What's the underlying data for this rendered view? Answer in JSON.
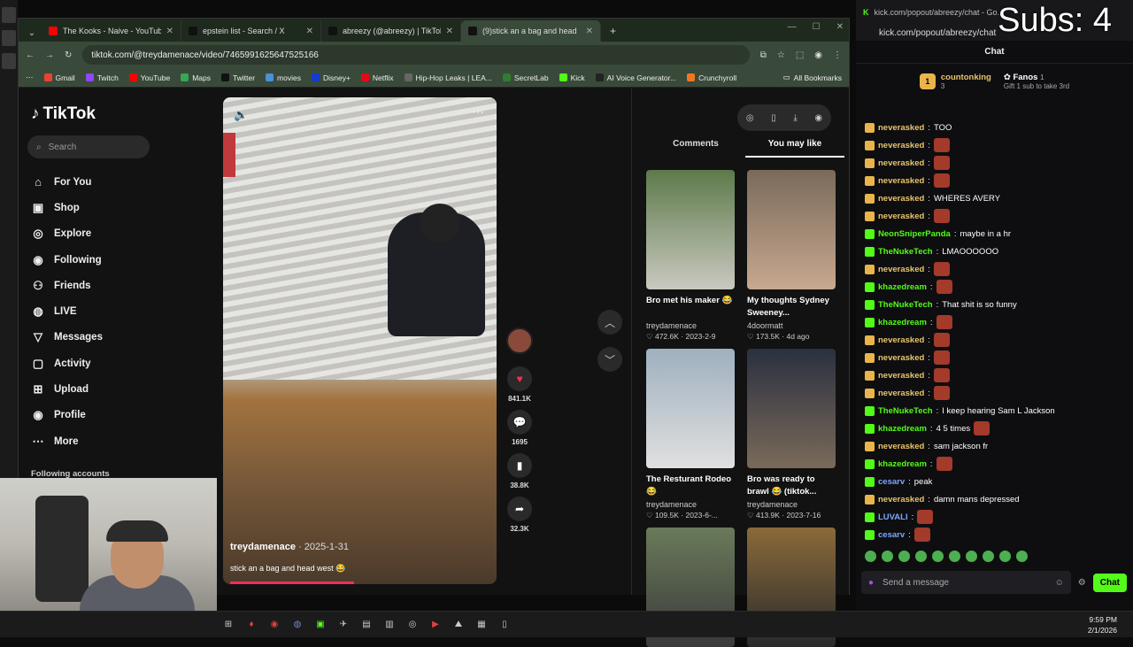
{
  "browser": {
    "tabs": [
      {
        "title": "The Kooks - Naive - YouTube",
        "color": "#ff0000",
        "active": false
      },
      {
        "title": "epstein list - Search / X",
        "color": "#111111",
        "active": false
      },
      {
        "title": "abreezy (@abreezy) | TikTok",
        "color": "#111111",
        "active": false
      },
      {
        "title": "(9)stick an a bag and head",
        "color": "#111111",
        "active": true
      }
    ],
    "url": "tiktok.com/@treydamenace/video/7465991625647525166",
    "bookmarks": [
      {
        "label": "Gmail",
        "color": "#ea4335"
      },
      {
        "label": "Twitch",
        "color": "#9146ff"
      },
      {
        "label": "YouTube",
        "color": "#ff0000"
      },
      {
        "label": "Maps",
        "color": "#34a853"
      },
      {
        "label": "Twitter",
        "color": "#111111"
      },
      {
        "label": "movies",
        "color": "#4a90d9"
      },
      {
        "label": "Disney+",
        "color": "#113ccf"
      },
      {
        "label": "Netflix",
        "color": "#e50914"
      },
      {
        "label": "Hip-Hop Leaks | LEA...",
        "color": "#666666"
      },
      {
        "label": "SecretLab",
        "color": "#2e7d32"
      },
      {
        "label": "Kick",
        "color": "#53fc18"
      },
      {
        "label": "AI Voice Generator...",
        "color": "#222222"
      },
      {
        "label": "Crunchyroll",
        "color": "#f47521"
      }
    ],
    "all_bookmarks": "All Bookmarks"
  },
  "tiktok": {
    "logo": "TikTok",
    "search_placeholder": "Search",
    "nav": [
      {
        "label": "For You",
        "icon": "home-icon"
      },
      {
        "label": "Shop",
        "icon": "shop-icon"
      },
      {
        "label": "Explore",
        "icon": "compass-icon"
      },
      {
        "label": "Following",
        "icon": "avatar-icon"
      },
      {
        "label": "Friends",
        "icon": "friends-icon"
      },
      {
        "label": "LIVE",
        "icon": "live-icon"
      },
      {
        "label": "Messages",
        "icon": "messages-icon"
      },
      {
        "label": "Activity",
        "icon": "activity-icon"
      },
      {
        "label": "Upload",
        "icon": "upload-icon"
      },
      {
        "label": "Profile",
        "icon": "profile-icon"
      },
      {
        "label": "More",
        "icon": "more-icon"
      }
    ],
    "following_accounts": "Following accounts",
    "video": {
      "user": "treydamenace",
      "date": "· 2025-1-31",
      "caption": "stick an a bag and head west 😂"
    },
    "actions": {
      "likes": "841.1K",
      "comments": "1695",
      "saves": "38.8K",
      "shares": "32.3K"
    },
    "panel_tabs": [
      "Comments",
      "You may like"
    ],
    "cards": [
      {
        "title": "Bro met his maker 😂",
        "user": "treydamenace",
        "meta": "♡ 472.6K · 2023-2-9",
        "c1": "#5d7a4a",
        "c2": "#c9c9c0"
      },
      {
        "title": "My thoughts Sydney Sweeney...",
        "user": "4doormatt",
        "meta": "♡ 173.5K · 4d ago",
        "c1": "#7a6a5a",
        "c2": "#c8a890"
      },
      {
        "title": "The Resturant Rodeo 😂",
        "user": "treydamenace",
        "meta": "♡ 109.5K · 2023-6-...",
        "c1": "#9fb0bf",
        "c2": "#e0e0e0"
      },
      {
        "title": "Bro was ready to brawl 😂 (tiktok...",
        "user": "treydamenace",
        "meta": "♡ 413.9K · 2023-7-16",
        "c1": "#2a3040",
        "c2": "#7a6a5a"
      },
      {
        "title": "",
        "user": "",
        "meta": "",
        "c1": "#6a7a5a",
        "c2": "#3a3a3a"
      },
      {
        "title": "",
        "user": "",
        "meta": "",
        "c1": "#8a6a3a",
        "c2": "#2a2a2a"
      }
    ]
  },
  "chat": {
    "popout_url": "kick.com/popout/abreezy/chat - Go...",
    "popout_url2": "kick.com/popout/abreezy/chat",
    "subs": "Subs: 4",
    "title": "Chat",
    "leader": {
      "rank": "1",
      "name": "countonking",
      "count": "3",
      "name2": "Fanos",
      "count2": "1",
      "sub": "Gift 1 sub to take 3rd"
    },
    "messages": [
      {
        "user": "neverasked",
        "text": "TOO",
        "color": "#e9c46a",
        "emote": false
      },
      {
        "user": "neverasked",
        "text": "",
        "color": "#e9c46a",
        "emote": true
      },
      {
        "user": "neverasked",
        "text": "",
        "color": "#e9c46a",
        "emote": true
      },
      {
        "user": "neverasked",
        "text": "",
        "color": "#e9c46a",
        "emote": true
      },
      {
        "user": "neverasked",
        "text": "WHERES AVERY",
        "color": "#e9c46a",
        "emote": false
      },
      {
        "user": "neverasked",
        "text": "",
        "color": "#e9c46a",
        "emote": true
      },
      {
        "user": "NeonSniperPanda",
        "text": "maybe in a hr",
        "color": "#53fc18",
        "emote": false
      },
      {
        "user": "TheNukeTech",
        "text": "LMAOOOOOO",
        "color": "#53fc18",
        "emote": false
      },
      {
        "user": "neverasked",
        "text": "",
        "color": "#e9c46a",
        "emote": true
      },
      {
        "user": "khazedream",
        "text": "",
        "color": "#53fc18",
        "emote": true
      },
      {
        "user": "TheNukeTech",
        "text": "That shit is so funny",
        "color": "#53fc18",
        "emote": false
      },
      {
        "user": "khazedream",
        "text": "",
        "color": "#53fc18",
        "emote": true
      },
      {
        "user": "neverasked",
        "text": "",
        "color": "#e9c46a",
        "emote": true
      },
      {
        "user": "neverasked",
        "text": "",
        "color": "#e9c46a",
        "emote": true
      },
      {
        "user": "neverasked",
        "text": "",
        "color": "#e9c46a",
        "emote": true
      },
      {
        "user": "neverasked",
        "text": "",
        "color": "#e9c46a",
        "emote": true
      },
      {
        "user": "TheNukeTech",
        "text": "I keep hearing Sam L Jackson",
        "color": "#53fc18",
        "emote": false
      },
      {
        "user": "khazedream",
        "text": "4 5 times",
        "color": "#53fc18",
        "emote": true
      },
      {
        "user": "neverasked",
        "text": "sam jackson fr",
        "color": "#e9c46a",
        "emote": false
      },
      {
        "user": "khazedream",
        "text": "",
        "color": "#53fc18",
        "emote": true
      },
      {
        "user": "cesarv",
        "text": "peak",
        "color": "#7aa7ff",
        "emote": false
      },
      {
        "user": "neverasked",
        "text": "damn mans depressed",
        "color": "#e9c46a",
        "emote": false
      },
      {
        "user": "LUVALI",
        "text": "",
        "color": "#7aa7ff",
        "emote": true
      },
      {
        "user": "cesarv",
        "text": "",
        "color": "#7aa7ff",
        "emote": true
      }
    ],
    "input_placeholder": "Send a message",
    "send_label": "Chat"
  },
  "taskbar": {
    "time": "9:59 PM",
    "date": "2/1/2026"
  }
}
